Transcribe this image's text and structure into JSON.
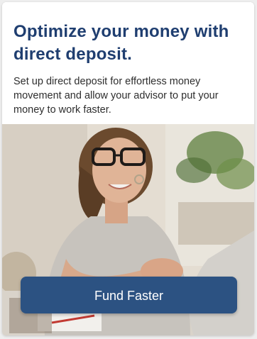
{
  "promo": {
    "headline": "Optimize your money with direct deposit.",
    "description": "Set up direct deposit for effortless money movement and allow your advisor to put your money to work faster.",
    "button_label": "Fund Faster"
  },
  "colors": {
    "headline": "#1f3e70",
    "button": "#2c5282",
    "button_text": "#ffffff"
  }
}
